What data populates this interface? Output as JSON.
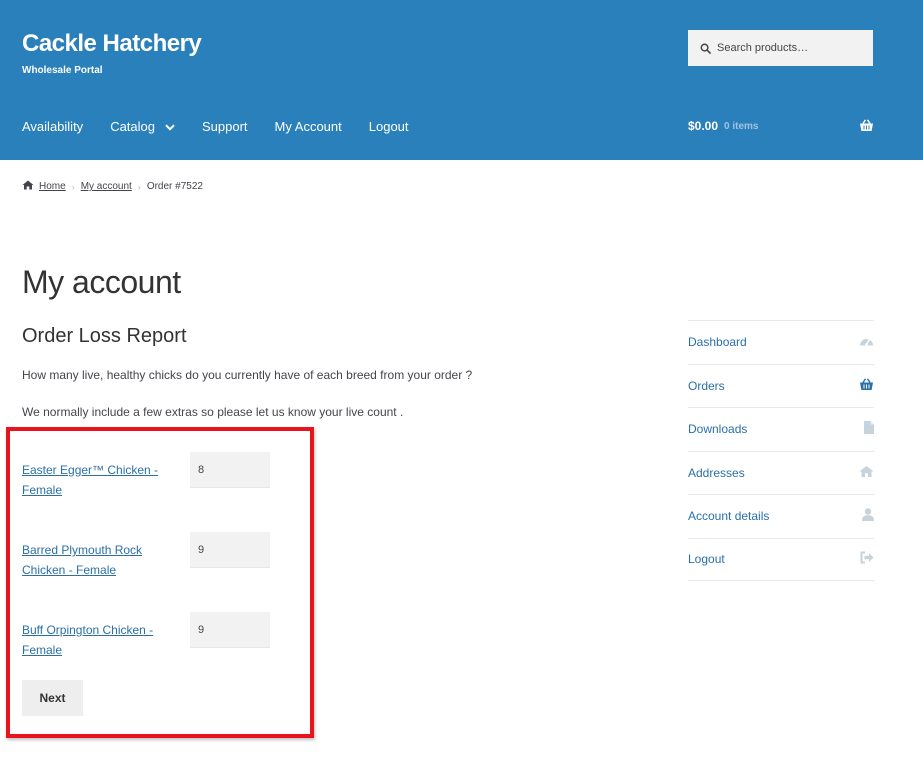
{
  "site": {
    "title": "Cackle Hatchery",
    "description": "Wholesale Portal"
  },
  "search": {
    "placeholder": "Search products…"
  },
  "nav": {
    "items": [
      {
        "label": "Availability"
      },
      {
        "label": "Catalog",
        "has_dropdown": true
      },
      {
        "label": "Support"
      },
      {
        "label": "My Account"
      },
      {
        "label": "Logout"
      }
    ]
  },
  "cart": {
    "total": "$0.00",
    "count": "0 items"
  },
  "breadcrumb": {
    "home": "Home",
    "account": "My account",
    "current": "Order #7522"
  },
  "main": {
    "page_title": "My account",
    "section_title": "Order Loss Report",
    "intro_question": "How many live, healthy chicks do you currently have of each breed from your order ?",
    "intro_note": "We normally include a few extras so please let us know your live count .",
    "breeds": [
      {
        "name": "Easter Egger™ Chicken - Female",
        "count": "8"
      },
      {
        "name": "Barred Plymouth Rock Chicken - Female",
        "count": "9"
      },
      {
        "name": "Buff Orpington Chicken - Female",
        "count": "9"
      }
    ],
    "next_label": "Next"
  },
  "sidebar": {
    "items": [
      {
        "label": "Dashboard",
        "icon": "dashboard-icon"
      },
      {
        "label": "Orders",
        "icon": "basket-icon"
      },
      {
        "label": "Downloads",
        "icon": "file-icon"
      },
      {
        "label": "Addresses",
        "icon": "home-icon"
      },
      {
        "label": "Account details",
        "icon": "user-icon"
      },
      {
        "label": "Logout",
        "icon": "sign-out-icon"
      }
    ]
  },
  "colors": {
    "header_bg": "#2a80ba",
    "link": "#2a6fa8",
    "highlight_border": "#e8141b",
    "icon_muted": "#c6d3dc"
  }
}
